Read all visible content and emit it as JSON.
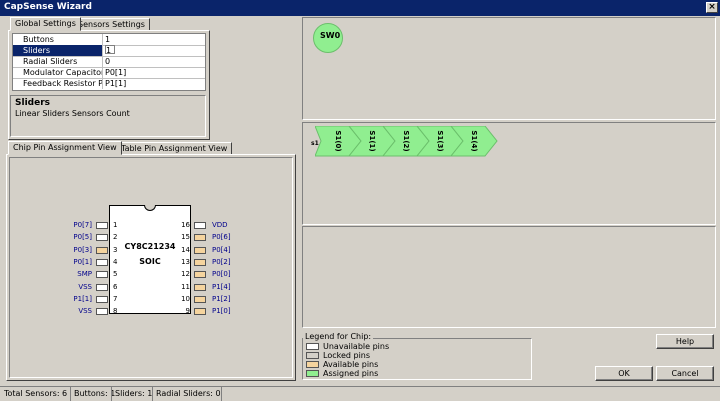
{
  "window": {
    "title": "CapSense Wizard",
    "close_glyph": "×"
  },
  "tabs_top": [
    {
      "label": "Global Settings",
      "active": true
    },
    {
      "label": "Sensors Settings",
      "active": false
    }
  ],
  "properties": [
    {
      "name": "Buttons",
      "value": "1"
    },
    {
      "name": "Sliders",
      "value": "1"
    },
    {
      "name": "Radial Sliders",
      "value": "0"
    },
    {
      "name": "Modulator Capacitor",
      "value": "P0[1]"
    },
    {
      "name": "Feedback Resistor Pi",
      "value": "P1[1]"
    }
  ],
  "description": {
    "title": "Sliders",
    "text": "Linear Sliders Sensors Count"
  },
  "tabs_bottom": [
    {
      "label": "Chip Pin Assignment View",
      "active": true
    },
    {
      "label": "Table Pin Assignment View",
      "active": false
    }
  ],
  "chip": {
    "name": "CY8C21234",
    "package": "SOIC",
    "left_pins": [
      {
        "num": "1",
        "label": "P0[7]",
        "status": "unavailable"
      },
      {
        "num": "2",
        "label": "P0[5]",
        "status": "unavailable"
      },
      {
        "num": "3",
        "label": "P0[3]",
        "status": "available"
      },
      {
        "num": "4",
        "label": "P0[1]",
        "status": "unavailable"
      },
      {
        "num": "5",
        "label": "SMP",
        "status": "unavailable"
      },
      {
        "num": "6",
        "label": "VSS",
        "status": "unavailable"
      },
      {
        "num": "7",
        "label": "P1[1]",
        "status": "unavailable"
      },
      {
        "num": "8",
        "label": "VSS",
        "status": "unavailable"
      }
    ],
    "right_pins": [
      {
        "num": "16",
        "label": "VDD",
        "status": "unavailable"
      },
      {
        "num": "15",
        "label": "P0[6]",
        "status": "available"
      },
      {
        "num": "14",
        "label": "P0[4]",
        "status": "available"
      },
      {
        "num": "13",
        "label": "P0[2]",
        "status": "available"
      },
      {
        "num": "12",
        "label": "P0[0]",
        "status": "available"
      },
      {
        "num": "11",
        "label": "P1[4]",
        "status": "available"
      },
      {
        "num": "10",
        "label": "P1[2]",
        "status": "available"
      },
      {
        "num": "9",
        "label": "P1[0]",
        "status": "available"
      }
    ]
  },
  "button_panel": {
    "button_label": "SW0"
  },
  "slider_panel": {
    "slider_label": "s1",
    "segments": [
      "S1(0)",
      "S1(1)",
      "S1(2)",
      "S1(3)",
      "S1(4)"
    ]
  },
  "legend": {
    "title": "Legend for Chip:",
    "items": [
      {
        "label": "Unavailable pins",
        "color": "#ffffff"
      },
      {
        "label": "Locked pins",
        "color": "#d4d0c8"
      },
      {
        "label": "Available pins",
        "color": "#f5d49e"
      },
      {
        "label": "Assigned pins",
        "color": "#90ee90"
      }
    ]
  },
  "buttons": {
    "help": "Help",
    "ok": "OK",
    "cancel": "Cancel"
  },
  "status_bar": [
    "Total Sensors: 6",
    "Buttons: 1",
    "Sliders: 1",
    "Radial Sliders: 0"
  ],
  "colors": {
    "pin_available": "#f5d49e",
    "pin_unavailable": "#ffffff",
    "sensor_assigned": "#90ee90",
    "titlebar": "#0a246a"
  }
}
